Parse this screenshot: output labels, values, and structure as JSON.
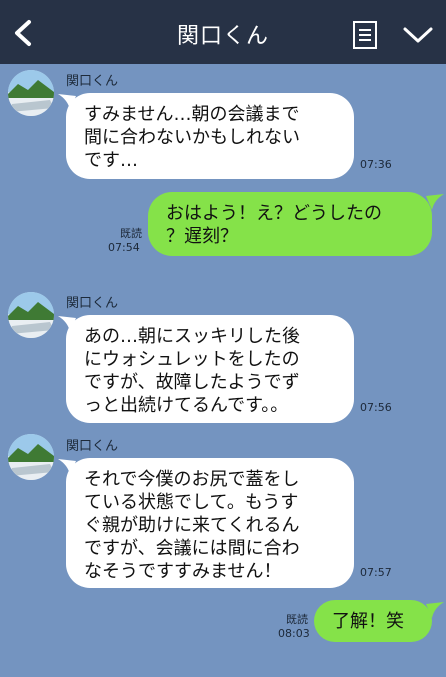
{
  "header": {
    "title": "関口くん",
    "back_icon": "chevron-left-icon",
    "menu_icon": "note-list-icon",
    "expand_icon": "chevron-down-icon",
    "bg_color": "#273246"
  },
  "chat": {
    "bg_color": "#7494c0",
    "incoming_color": "#ffffff",
    "outgoing_color": "#85e249",
    "messages": [
      {
        "direction": "in",
        "sender": "関口くん",
        "lines": [
          "すみません…朝の会議まで",
          "間に合わないかもしれない",
          "です…"
        ],
        "time": "07:36"
      },
      {
        "direction": "out",
        "lines": [
          "おはよう！え？どうしたの",
          "？遅刻？"
        ],
        "read": "既読",
        "time": "07:54"
      },
      {
        "direction": "in",
        "sender": "関口くん",
        "lines": [
          "あの…朝にスッキリした後",
          "にウォシュレットをしたの",
          "ですが、故障したようでず",
          "っと出続けてるんです。。"
        ],
        "time": "07:56"
      },
      {
        "direction": "in",
        "sender": "関口くん",
        "lines": [
          "それで今僕のお尻で蓋をし",
          "ている状態でして。もうす",
          "ぐ親が助けに来てくれるん",
          "ですが、会議には間に合わ",
          "なそうですすみません！"
        ],
        "time": "07:57"
      },
      {
        "direction": "out",
        "lines": [
          "了解！笑"
        ],
        "read": "既読",
        "time": "08:03"
      }
    ]
  }
}
